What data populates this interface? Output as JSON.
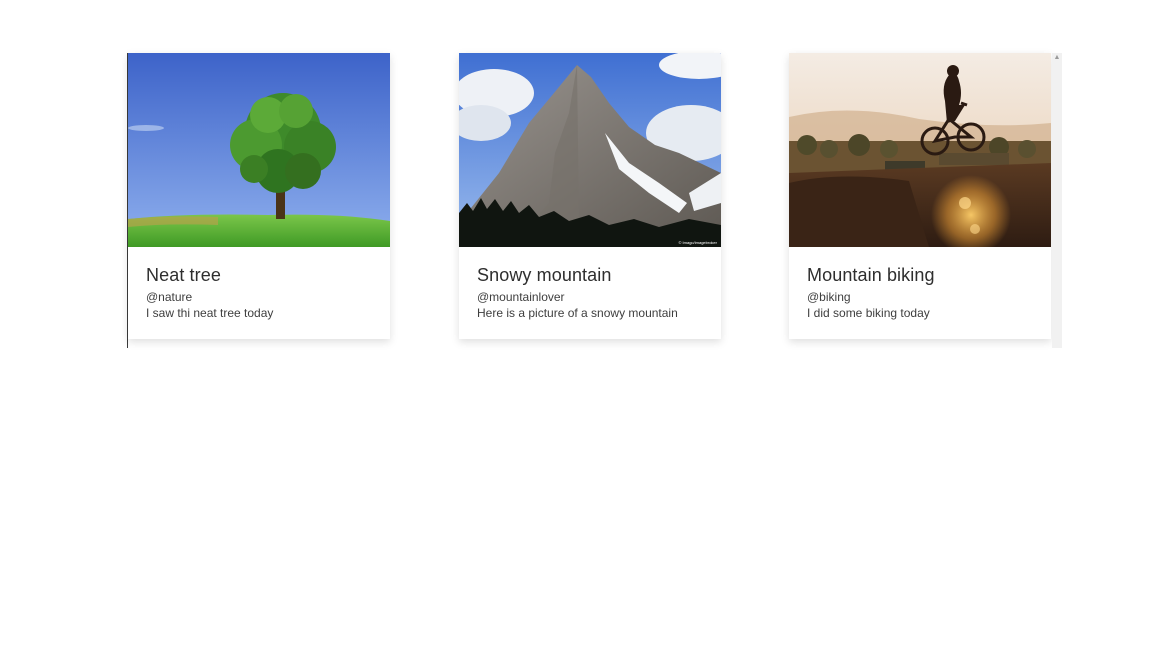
{
  "cards": [
    {
      "title": "Neat tree",
      "handle": "@nature",
      "description": "I saw thi neat tree today",
      "image": "tree-on-hill-photo"
    },
    {
      "title": "Snowy mountain",
      "handle": "@mountainlover",
      "description": "Here is a picture of a snowy mountain",
      "image": "snowy-mountain-photo",
      "watermark": "© Imago/imagebroker"
    },
    {
      "title": "Mountain biking",
      "handle": "@biking",
      "description": "I did some biking today",
      "image": "mountain-biker-sunset-photo"
    }
  ],
  "scrollbar": {
    "up_arrow": "▲"
  }
}
